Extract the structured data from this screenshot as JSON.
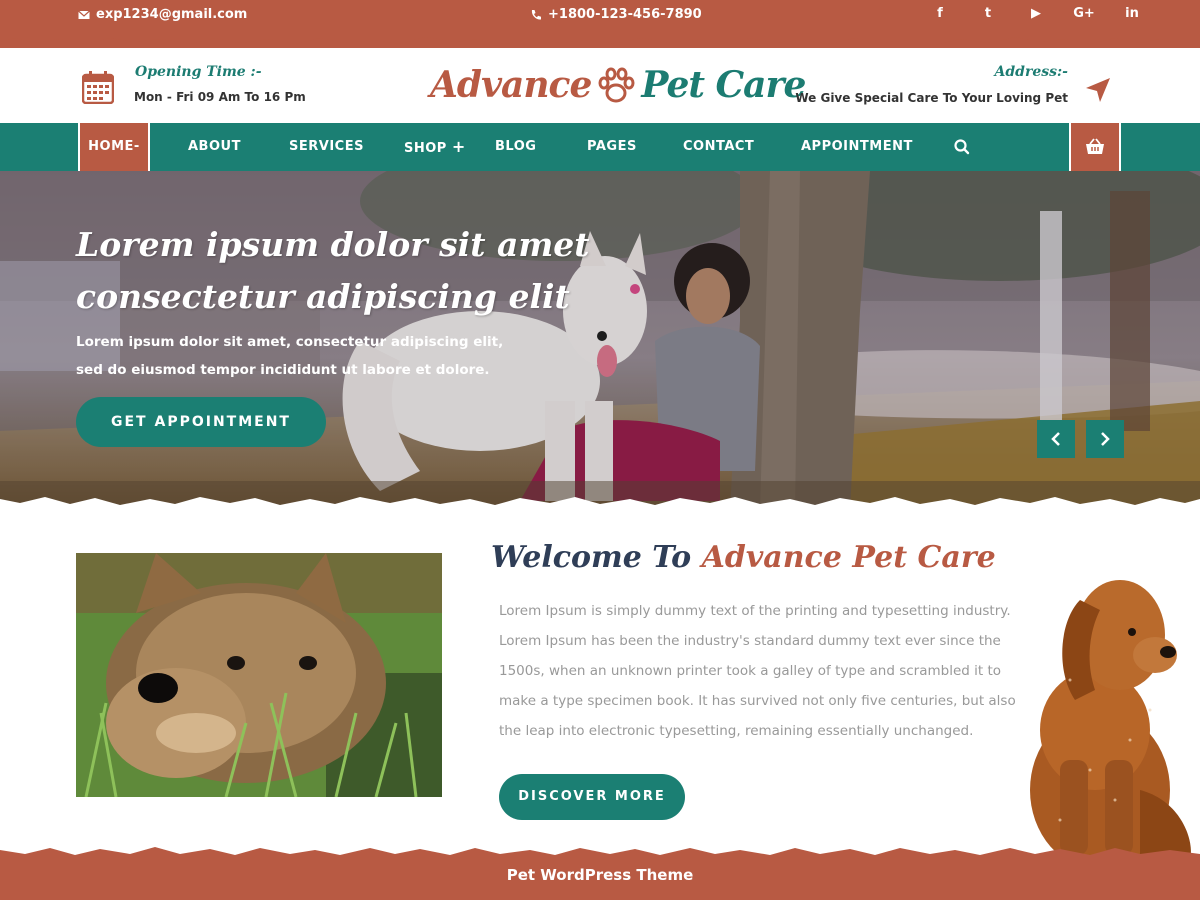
{
  "topbar": {
    "email": "exp1234@gmail.com",
    "phone": "+1800-123-456-7890",
    "social": [
      {
        "icon": "facebook-icon",
        "glyph": "f"
      },
      {
        "icon": "twitter-icon",
        "glyph": "t"
      },
      {
        "icon": "youtube-icon",
        "glyph": "▶"
      },
      {
        "icon": "google-plus-icon",
        "glyph": "G+"
      },
      {
        "icon": "linkedin-icon",
        "glyph": "in"
      }
    ]
  },
  "header": {
    "opening_label": "Opening Time :-",
    "opening_value": "Mon - Fri 09 Am To 16 Pm",
    "logo_part1": "Advance",
    "logo_part2": "Pet Care",
    "address_label": "Address:-",
    "address_value": "We Give Special Care To Your Loving Pet"
  },
  "nav": {
    "items": [
      "HOME",
      "ABOUT",
      "SERVICES",
      "SHOP",
      "BLOG",
      "PAGES",
      "CONTACT",
      "APPOINTMENT"
    ],
    "home_suffix": "-",
    "shop_suffix": "+"
  },
  "hero": {
    "title": "Lorem ipsum dolor sit amet consectetur adipiscing elit",
    "text": "Lorem ipsum dolor sit amet, consectetur adipiscing elit, sed do eiusmod tempor incididunt ut labore et dolore.",
    "button": "GET APPOINTMENT"
  },
  "welcome": {
    "title_part1": "Welcome To",
    "title_part2": "Advance Pet Care",
    "body": "Lorem Ipsum is simply dummy text of the printing and typesetting industry. Lorem Ipsum has been the industry's standard dummy text ever since the 1500s, when an unknown printer took a galley of type and scrambled it to make a type specimen book. It has survived not only five centuries, but also the leap into electronic typesetting, remaining essentially unchanged.",
    "button": "DISCOVER MORE"
  },
  "footer": {
    "text": "Pet WordPress Theme"
  },
  "colors": {
    "brand_rust": "#b85a43",
    "brand_teal": "#1b7f73",
    "heading_navy": "#2f3e57"
  }
}
